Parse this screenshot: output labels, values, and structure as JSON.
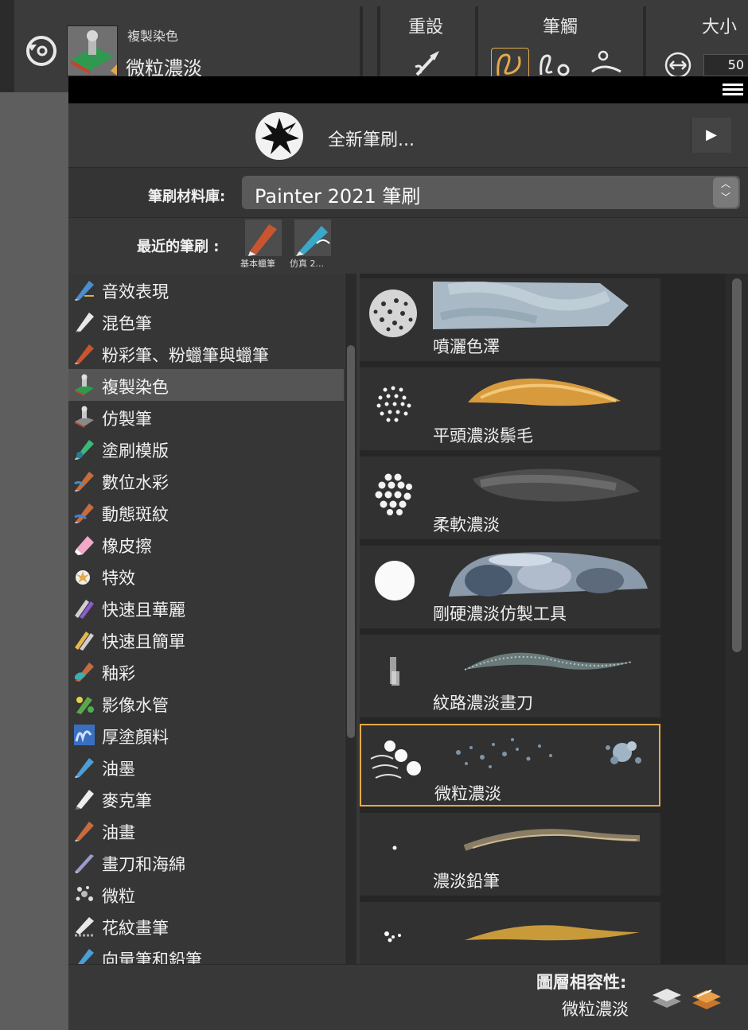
{
  "toolbar": {
    "current_category": "複製染色",
    "current_variant": "微粒濃淡",
    "reset_label": "重設",
    "stroke_label": "筆觸",
    "size_label": "大小",
    "size_value": "50",
    "icons": [
      "reset-tool-icon",
      "brush-reset-icon",
      "freehand-stroke-icon",
      "straight-line-stroke-icon",
      "stroke-attributes-icon",
      "size-adjust-icon"
    ]
  },
  "panel": {
    "menu_icon": "hamburger-menu-icon",
    "new_brush_label": "全新筆刷...",
    "library_label": "筆刷材料庫:",
    "library_value": "Painter 2021 筆刷",
    "recent_label": "最近的筆刷 :",
    "recent": [
      {
        "caption": "基本蠟筆",
        "icon": "pastel-brush-icon"
      },
      {
        "caption": "仿真 2...",
        "icon": "pen-brush-icon"
      }
    ],
    "categories": [
      {
        "label": "音效表現",
        "icon": "audio-expression-icon"
      },
      {
        "label": "混色筆",
        "icon": "blender-icon"
      },
      {
        "label": "粉彩筆、粉蠟筆與蠟筆",
        "icon": "pastel-icon"
      },
      {
        "label": "複製染色",
        "icon": "cloner-icon",
        "selected": true
      },
      {
        "label": "仿製筆",
        "icon": "clone-brush-icon"
      },
      {
        "label": "塗刷模版",
        "icon": "stencil-icon"
      },
      {
        "label": "數位水彩",
        "icon": "digital-watercolor-icon"
      },
      {
        "label": "動態斑紋",
        "icon": "dynamic-speckle-icon"
      },
      {
        "label": "橡皮擦",
        "icon": "eraser-icon"
      },
      {
        "label": "特效",
        "icon": "fx-icon"
      },
      {
        "label": "快速且華麗",
        "icon": "fast-fancy-icon"
      },
      {
        "label": "快速且簡單",
        "icon": "fast-simple-icon"
      },
      {
        "label": "釉彩",
        "icon": "glazing-icon"
      },
      {
        "label": "影像水管",
        "icon": "image-hose-icon"
      },
      {
        "label": "厚塗顏料",
        "icon": "impasto-icon"
      },
      {
        "label": "油墨",
        "icon": "ink-icon"
      },
      {
        "label": "麥克筆",
        "icon": "marker-icon"
      },
      {
        "label": "油畫",
        "icon": "oil-icon"
      },
      {
        "label": "畫刀和海綿",
        "icon": "palette-knife-icon"
      },
      {
        "label": "微粒",
        "icon": "particle-icon"
      },
      {
        "label": "花紋畫筆",
        "icon": "pattern-pen-icon"
      },
      {
        "label": "向量筆和鉛筆",
        "icon": "vector-pen-icon"
      }
    ],
    "variants": [
      {
        "label": "噴灑色澤",
        "dab": "scatter"
      },
      {
        "label": "平頭濃淡鬃毛",
        "dab": "dots-medium"
      },
      {
        "label": "柔軟濃淡",
        "dab": "dots-large"
      },
      {
        "label": "剛硬濃淡仿製工具",
        "dab": "solid"
      },
      {
        "label": "紋路濃淡畫刀",
        "dab": "grain"
      },
      {
        "label": "微粒濃淡",
        "dab": "particles",
        "selected": true
      },
      {
        "label": "濃淡鉛筆",
        "dab": "point"
      },
      {
        "label": "",
        "dab": "splash"
      }
    ],
    "footer_label": "圖層相容性:",
    "footer_value": "微粒濃淡"
  },
  "colors": {
    "accent": "#e4a94a",
    "panel_bg": "#383838",
    "selected_row": "#555555"
  }
}
